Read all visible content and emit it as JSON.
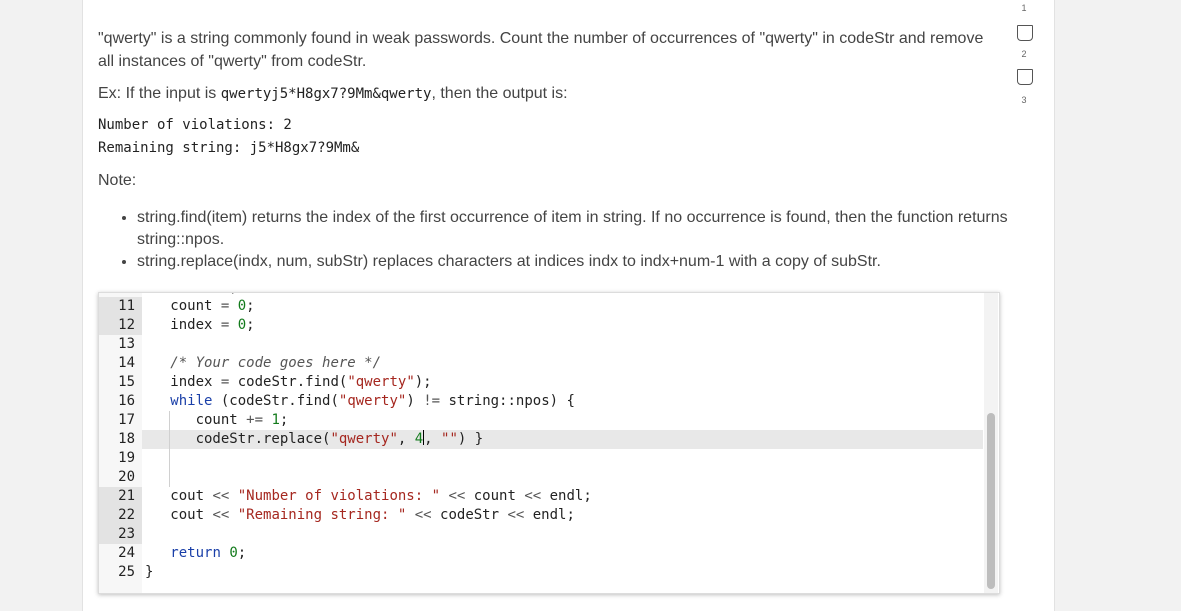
{
  "problem": {
    "description": "\"qwerty\" is a string commonly found in weak passwords. Count the number of occurrences of \"qwerty\" in codeStr and remove all instances of \"qwerty\" from codeStr.",
    "example_prefix": "Ex: If the input is ",
    "example_input": "qwertyj5*H8gx7?9Mm&qwerty",
    "example_suffix": ", then the output is:",
    "output_line1": "Number of violations: 2",
    "output_line2": "Remaining string: j5*H8gx7?9Mm&",
    "note_label": "Note:",
    "notes": [
      "string.find(item) returns the index of the first occurrence of item in string. If no occurrence is found, then the function returns string::npos.",
      "string.replace(indx, num, subStr) replaces characters at indices indx to indx+num-1 with a copy of subStr."
    ]
  },
  "editor": {
    "line_numbers": [
      "11",
      "12",
      "13",
      "14",
      "15",
      "16",
      "17",
      "18",
      "19",
      "20",
      "21",
      "22",
      "23",
      "24",
      "25"
    ],
    "highlighted_gutter_lines": [
      "11",
      "12",
      "21",
      "22",
      "23"
    ],
    "active_line": "18"
  },
  "checkpoints": {
    "numbers": [
      "1",
      "2",
      "3"
    ],
    "icon": "checkpoint-box-icon"
  },
  "colors": {
    "keyword": "#1a3fa8",
    "string": "#a5271f",
    "number": "#127a1b",
    "background": "#f2f2f2"
  }
}
